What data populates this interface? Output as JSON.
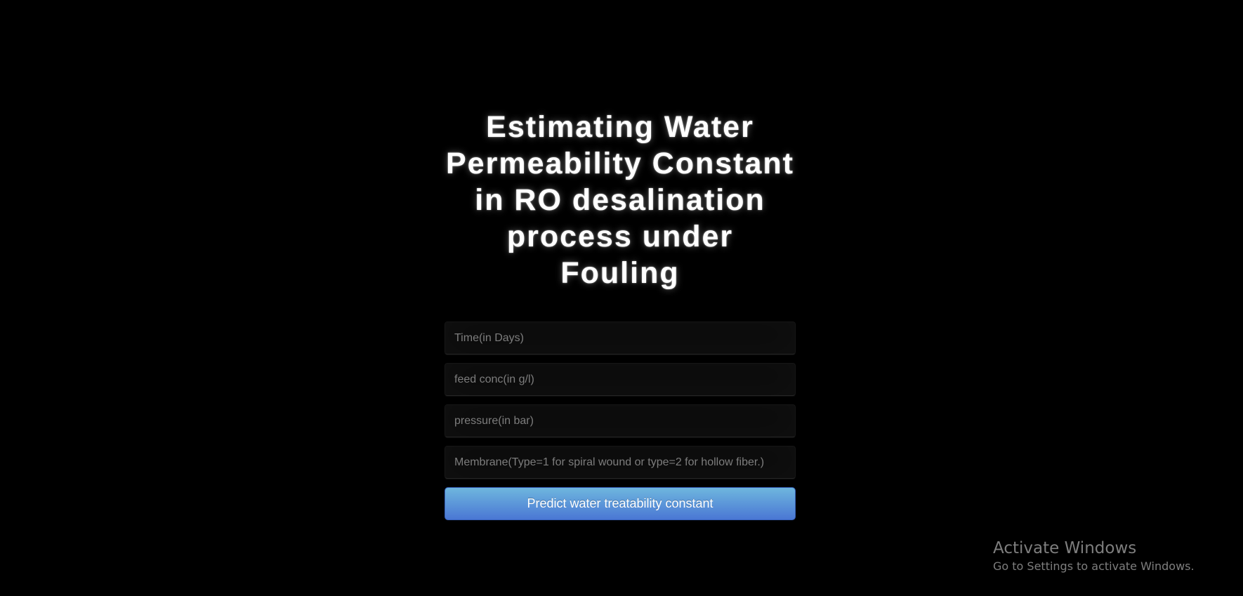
{
  "page": {
    "title": "Estimating Water Permeability Constant in RO desalination process under Fouling"
  },
  "form": {
    "fields": [
      {
        "placeholder": "Time(in Days)",
        "value": ""
      },
      {
        "placeholder": "feed conc(in g/l)",
        "value": ""
      },
      {
        "placeholder": "pressure(in bar)",
        "value": ""
      },
      {
        "placeholder": "Membrane(Type=1 for spiral wound or type=2 for hollow fiber.)",
        "value": ""
      }
    ],
    "submit_label": "Predict water treatability constant"
  },
  "watermark": {
    "title": "Activate Windows",
    "subtitle": "Go to Settings to activate Windows."
  },
  "colors": {
    "background": "#000000",
    "title_text": "#ffffff",
    "button_top": "#6eb6de",
    "button_bottom": "#4a77d4",
    "field_bg": "#0c0c0c",
    "placeholder": "#7d7d7d"
  }
}
